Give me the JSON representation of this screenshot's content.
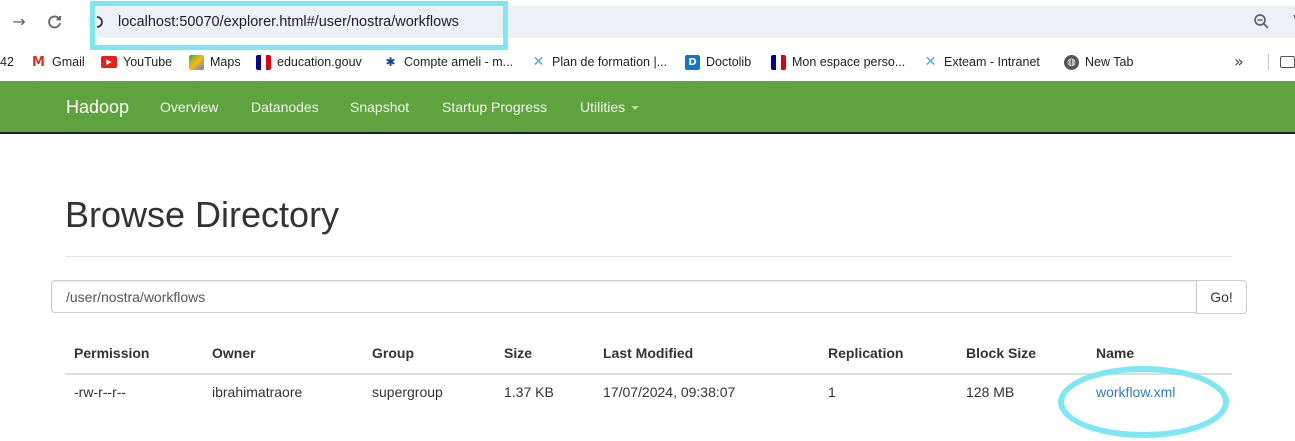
{
  "browser": {
    "url": "localhost:50070/explorer.html#/user/nostra/workflows",
    "nav_icons": [
      "back-arrow-icon",
      "reload-icon",
      "site-info-icon",
      "zoom-icon",
      "bookmark-star-icon"
    ],
    "bookmarks": [
      {
        "label": "42",
        "icon": "none"
      },
      {
        "label": "Gmail",
        "icon": "gmail-icon"
      },
      {
        "label": "YouTube",
        "icon": "youtube-icon"
      },
      {
        "label": "Maps",
        "icon": "maps-icon"
      },
      {
        "label": "education.gouv",
        "icon": "marianne-icon"
      },
      {
        "label": "Compte ameli - m...",
        "icon": "ameli-icon"
      },
      {
        "label": "Plan de formation |...",
        "icon": "cross-icon"
      },
      {
        "label": "Doctolib",
        "icon": "doctolib-icon"
      },
      {
        "label": "Mon espace perso...",
        "icon": "marianne-icon"
      },
      {
        "label": "Exteam - Intranet",
        "icon": "cross-icon"
      },
      {
        "label": "New Tab",
        "icon": "globe-icon"
      }
    ],
    "more_label": "»"
  },
  "navbar": {
    "brand": "Hadoop",
    "links": [
      "Overview",
      "Datanodes",
      "Snapshot",
      "Startup Progress",
      "Utilities"
    ],
    "color": "#5fa33e"
  },
  "main": {
    "title": "Browse Directory",
    "path_value": "/user/nostra/workflows",
    "go_label": "Go!",
    "table": {
      "headers": [
        "Permission",
        "Owner",
        "Group",
        "Size",
        "Last Modified",
        "Replication",
        "Block Size",
        "Name"
      ],
      "rows": [
        {
          "permission": "-rw-r--r--",
          "owner": "ibrahimatraore",
          "group": "supergroup",
          "size": "1.37 KB",
          "last_modified": "17/07/2024, 09:38:07",
          "replication": "1",
          "block_size": "128 MB",
          "name": "workflow.xml"
        }
      ]
    }
  },
  "annotation_color": "#7de8f2"
}
